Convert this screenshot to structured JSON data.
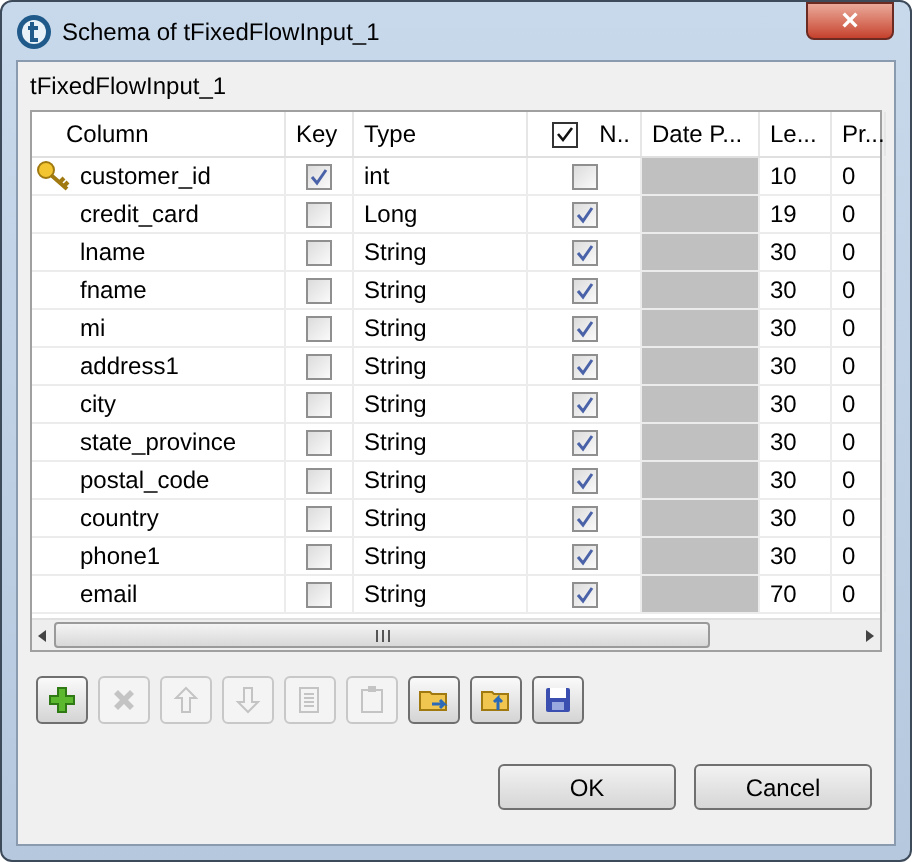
{
  "window": {
    "title": "Schema of tFixedFlowInput_1",
    "close": "×"
  },
  "group_label": "tFixedFlowInput_1",
  "table": {
    "columns": [
      "Column",
      "Key",
      "Type",
      "N..",
      "Date P...",
      "Le...",
      "Pr..."
    ],
    "header_checked": true,
    "rows": [
      {
        "name": "customer_id",
        "primary": true,
        "key": true,
        "type": "int",
        "nullable": false,
        "length": "10",
        "precision": "0"
      },
      {
        "name": "credit_card",
        "primary": false,
        "key": false,
        "type": "Long",
        "nullable": true,
        "length": "19",
        "precision": "0"
      },
      {
        "name": "lname",
        "primary": false,
        "key": false,
        "type": "String",
        "nullable": true,
        "length": "30",
        "precision": "0"
      },
      {
        "name": "fname",
        "primary": false,
        "key": false,
        "type": "String",
        "nullable": true,
        "length": "30",
        "precision": "0"
      },
      {
        "name": "mi",
        "primary": false,
        "key": false,
        "type": "String",
        "nullable": true,
        "length": "30",
        "precision": "0"
      },
      {
        "name": "address1",
        "primary": false,
        "key": false,
        "type": "String",
        "nullable": true,
        "length": "30",
        "precision": "0"
      },
      {
        "name": "city",
        "primary": false,
        "key": false,
        "type": "String",
        "nullable": true,
        "length": "30",
        "precision": "0"
      },
      {
        "name": "state_province",
        "primary": false,
        "key": false,
        "type": "String",
        "nullable": true,
        "length": "30",
        "precision": "0"
      },
      {
        "name": "postal_code",
        "primary": false,
        "key": false,
        "type": "String",
        "nullable": true,
        "length": "30",
        "precision": "0"
      },
      {
        "name": "country",
        "primary": false,
        "key": false,
        "type": "String",
        "nullable": true,
        "length": "30",
        "precision": "0"
      },
      {
        "name": "phone1",
        "primary": false,
        "key": false,
        "type": "String",
        "nullable": true,
        "length": "30",
        "precision": "0"
      },
      {
        "name": "email",
        "primary": false,
        "key": false,
        "type": "String",
        "nullable": true,
        "length": "70",
        "precision": "0"
      }
    ]
  },
  "toolbar": [
    {
      "kind": "add",
      "disabled": false
    },
    {
      "kind": "remove",
      "disabled": true
    },
    {
      "kind": "up",
      "disabled": true
    },
    {
      "kind": "down",
      "disabled": true
    },
    {
      "kind": "copy",
      "disabled": true
    },
    {
      "kind": "paste",
      "disabled": true
    },
    {
      "kind": "import",
      "disabled": false
    },
    {
      "kind": "export",
      "disabled": false
    },
    {
      "kind": "save",
      "disabled": false
    }
  ],
  "buttons": [
    "OK",
    "Cancel"
  ]
}
